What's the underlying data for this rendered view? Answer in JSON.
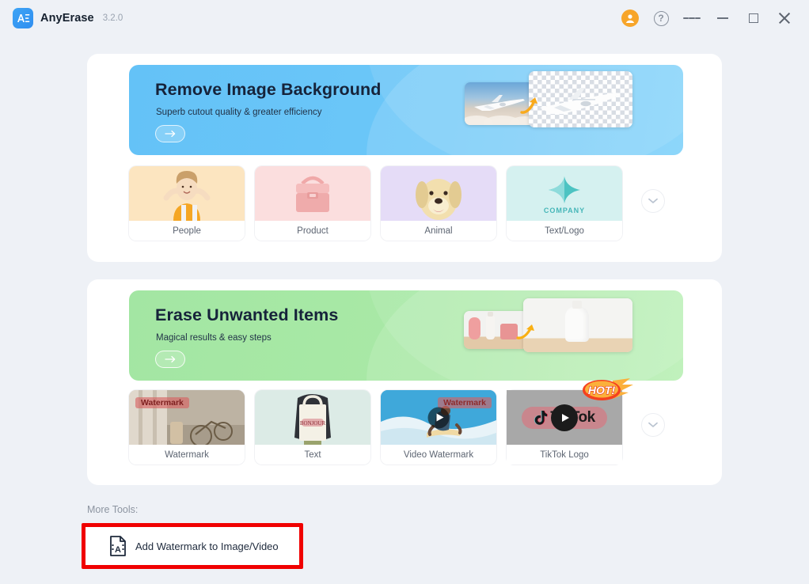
{
  "titlebar": {
    "app_name": "AnyErase",
    "version": "3.2.0",
    "logo_text": "AE",
    "icons": [
      {
        "name": "account-avatar-icon",
        "glyph": "person",
        "color": "#f7a52a"
      },
      {
        "name": "help-icon",
        "glyph": "?"
      },
      {
        "name": "menu-icon",
        "glyph": "hamburger"
      },
      {
        "name": "minimize-icon",
        "glyph": "minus"
      },
      {
        "name": "maximize-icon",
        "glyph": "square"
      },
      {
        "name": "close-icon",
        "glyph": "x"
      }
    ]
  },
  "sections": [
    {
      "id": "remove-background",
      "banner": {
        "title": "Remove Image Background",
        "subtitle": "Superb cutout quality & greater efficiency",
        "cta_icon": "arrow-right-icon",
        "bg_color": "#6cc7f8"
      },
      "tiles": [
        {
          "label": "People",
          "bg": "#fce5c0"
        },
        {
          "label": "Product",
          "bg": "#fbdede"
        },
        {
          "label": "Animal",
          "bg": "#e5dcf7"
        },
        {
          "label": "Text/Logo",
          "bg": "#d5f1f0",
          "overlay_text": "COMPANY"
        }
      ],
      "expand_icon": "chevron-down-icon"
    },
    {
      "id": "erase-items",
      "banner": {
        "title": "Erase Unwanted Items",
        "subtitle": "Magical results & easy steps",
        "cta_icon": "arrow-right-icon",
        "bg_color": "#a9e9a6"
      },
      "tiles": [
        {
          "label": "Watermark",
          "overlay_text": "Watermark"
        },
        {
          "label": "Text",
          "overlay_text": "BONJOUR"
        },
        {
          "label": "Video Watermark",
          "overlay_text": "Watermark",
          "has_play": true
        },
        {
          "label": "TikTok Logo",
          "overlay_text": "TikTok",
          "has_play": true,
          "badge": "HOT!"
        }
      ],
      "expand_icon": "chevron-down-icon"
    }
  ],
  "more_tools": {
    "label": "More Tools:",
    "button_label": "Add Watermark to Image/Video",
    "button_icon": "document-watermark-icon",
    "highlight_color": "#f00000"
  }
}
